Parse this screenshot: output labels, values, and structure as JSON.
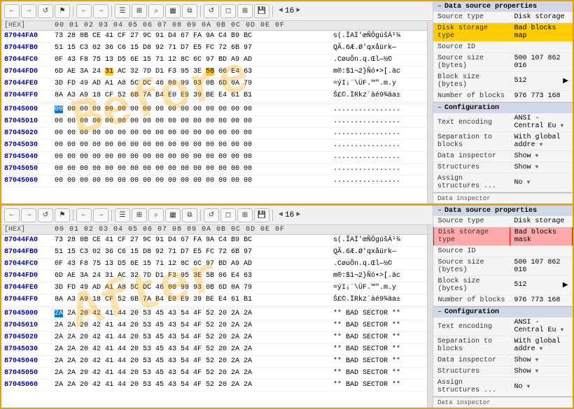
{
  "panels": [
    {
      "id": "top",
      "toolbar": {
        "buttons": [
          "←",
          "→",
          "↺",
          "⚑",
          "←",
          "→",
          "≡",
          "⊞",
          "☰",
          "⌕",
          "▦",
          "⧉",
          "↺",
          "◻",
          "⊞",
          "💾"
        ],
        "page": "◄ 16 ►"
      },
      "header": {
        "addr": "[HEX]",
        "bytes": "00  01  02  03  04  05  06  07  08  09  0A  0B  0C  0D  0E  0F",
        "chars": ""
      },
      "rows": [
        {
          "addr": "87044FA0",
          "data": "73 28 0B CE 41 CF 27 9C 91 D4 67 FA 9A C4 B9 BC",
          "ascii": "s(.ÎAÏ'\\u009cÑÔgúšÄ¹¼"
        },
        {
          "addr": "87044FB0",
          "data": "51 15 C3 02 36 C6 15 D8 92 71 D7 E5 FC 72 6B 97",
          "ascii": "QÃ.6Æ.Ø\\u0092qxåür k\\u0097"
        },
        {
          "addr": "87044FC0",
          "data": "0F 43 F8 75 13 D5 6E 15 71 12 8C 6C 97 BD A9 AD",
          "ascii": ".CøuÕn.q.\\u008cl\\u0097½©"
        },
        {
          "addr": "87044FD0",
          "data": "6D AE 3A 24 31 AC 32 7D D1 F3 95 3E 5B 06 E4 63",
          "ascii": "m®:$1¬2}Ñó\\u0095>[.äc"
        },
        {
          "addr": "87044FE0",
          "data": "3D FD 49 AD A1 A8 5C DC 46 00 99 93 0B 6D 0A 79",
          "ascii": "=ýI\\u00ad¡¨\\\\ÜF.\\u0099\\u0093.m.y"
        },
        {
          "addr": "87044FF0",
          "data": "8A A3 A9 18 CF 52 6B 7A B4 E0 E9 39 BE E4 61 B1",
          "ascii": "\\u008a¢©.ÏRkz´àé9¾äa±"
        },
        {
          "addr": "",
          "data": "",
          "ascii": "",
          "empty": true
        },
        {
          "addr": "87045000",
          "data": "00 00 00 00 00 00 00 00 00 00 00 00 00 00 00 00",
          "ascii": "................",
          "highlight_byte": 0
        },
        {
          "addr": "87045010",
          "data": "00 00 00 00 00 00 00 00 00 00 00 00 00 00 00 00",
          "ascii": "................"
        },
        {
          "addr": "87045020",
          "data": "00 00 00 00 00 00 00 00 00 00 00 00 00 00 00 00",
          "ascii": "................"
        },
        {
          "addr": "87045030",
          "data": "00 00 00 00 00 00 00 00 00 00 00 00 00 00 00 00",
          "ascii": "................"
        },
        {
          "addr": "87045040",
          "data": "00 00 00 00 00 00 00 00 00 00 00 00 00 00 00 00",
          "ascii": "................"
        },
        {
          "addr": "87045050",
          "data": "00 00 00 00 00 00 00 00 00 00 00 00 00 00 00 00",
          "ascii": "................"
        },
        {
          "addr": "87045060",
          "data": "00 00 00 00 00 00 00 00 00 00 00 00 00 00 00 00",
          "ascii": "................"
        }
      ],
      "properties": {
        "header": "Data source properties",
        "items": [
          {
            "label": "Source type",
            "value": "Disk storage",
            "highlight": false
          },
          {
            "label": "Disk storage type",
            "value": "Bad blocks map",
            "highlight": true
          },
          {
            "label": "Source ID",
            "value": "",
            "highlight": false
          },
          {
            "label": "Source size (bytes)",
            "value": "500 107 862 016",
            "highlight": false
          },
          {
            "label": "Block size (bytes)",
            "value": "512",
            "highlight": false
          },
          {
            "label": "Number of blocks",
            "value": "976 773 168",
            "highlight": false
          }
        ]
      },
      "configuration": {
        "header": "Configuration",
        "items": [
          {
            "label": "Text encoding",
            "value": "ANSI - Central Eu ▼"
          },
          {
            "label": "Separation to blocks",
            "value": "With global addre ▼"
          },
          {
            "label": "Data inspector",
            "value": "Show ▼"
          },
          {
            "label": "Structures",
            "value": "Show ▼"
          },
          {
            "label": "Assign structures ...",
            "value": "No ▼"
          }
        ]
      }
    },
    {
      "id": "bottom",
      "toolbar": {
        "buttons": [
          "←",
          "→",
          "↺",
          "⚑",
          "←",
          "→",
          "≡",
          "⊞",
          "☰",
          "⌕",
          "▦",
          "⧉",
          "↺",
          "◻",
          "⊞",
          "💾"
        ],
        "page": "◄ 16 ►"
      },
      "header": {
        "addr": "[HEX]",
        "bytes": "00  01  02  03  04  05  06  07  08  09  0A  0B  0C  0D  0E  0F",
        "chars": ""
      },
      "rows": [
        {
          "addr": "87044FA0",
          "data": "73 28 0B CE 41 CF 27 9C 91 D4 67 FA 9A C4 B9 BC",
          "ascii": "s(.ÎAÏ'\\u009cÑÔgúšÄ¹¼"
        },
        {
          "addr": "87044FB0",
          "data": "51 15 C3 02 36 C6 15 D8 92 71 D7 E5 FC 72 6B 97",
          "ascii": "QÃ.6Æ.Ø\\u0092qxåür k\\u0097"
        },
        {
          "addr": "87044FC0",
          "data": "0F 43 F8 75 13 D5 6E 15 71 12 8C 6C 97 BD A9 AD",
          "ascii": ".CøuÕn.q.\\u008cl\\u0097½©"
        },
        {
          "addr": "87044FD0",
          "data": "6D AE 3A 24 31 AC 32 7D D1 F3 95 3E 5B 06 E4 63",
          "ascii": "m®:$1¬2}Ñó\\u0095>[.äc"
        },
        {
          "addr": "87044FE0",
          "data": "3D FD 49 AD A1 A8 5C DC 46 00 99 93 0B 6D 0A 79",
          "ascii": "=ýI\\u00ad¡¨\\\\ÜF.\\u0099\\u0093.m.y"
        },
        {
          "addr": "87044FF0",
          "data": "8A A3 A9 18 CF 52 6B 7A B4 E0 E9 39 BE E4 61 B1",
          "ascii": "\\u008a¢©.ÏRkz´àé9¾äa±"
        },
        {
          "addr": "",
          "data": "",
          "ascii": "",
          "empty": true
        },
        {
          "addr": "87045000",
          "data": "2A 2A 20 42 41 44 20 53 45 43 54 4F 52 20 2A 2A",
          "ascii": "** BAD SECTOR **",
          "highlight_byte": 0,
          "first_byte": "2A"
        },
        {
          "addr": "87045010",
          "data": "2A 2A 20 42 41 44 20 53 45 43 54 4F 52 20 2A 2A",
          "ascii": "** BAD SECTOR **"
        },
        {
          "addr": "87045020",
          "data": "2A 2A 20 42 41 44 20 53 45 43 54 4F 52 20 2A 2A",
          "ascii": "** BAD SECTOR **"
        },
        {
          "addr": "87045030",
          "data": "2A 2A 20 42 41 44 20 53 45 43 54 4F 52 20 2A 2A",
          "ascii": "** BAD SECTOR **"
        },
        {
          "addr": "87045040",
          "data": "2A 2A 20 42 41 44 20 53 45 43 54 4F 52 20 2A 2A",
          "ascii": "** BAD SECTOR **"
        },
        {
          "addr": "87045050",
          "data": "2A 2A 20 42 41 44 20 53 45 43 54 4F 52 20 2A 2A",
          "ascii": "** BAD SECTOR **"
        },
        {
          "addr": "87045060",
          "data": "2A 2A 20 42 41 44 20 53 45 43 54 4F 52 20 2A 2A",
          "ascii": "** BAD SECTOR **"
        }
      ],
      "properties": {
        "header": "Data source properties",
        "items": [
          {
            "label": "Source type",
            "value": "Disk storage",
            "highlight": false
          },
          {
            "label": "Disk storage type",
            "value": "Bad blocks mask",
            "highlight": true,
            "highlight_red": true
          },
          {
            "label": "Source ID",
            "value": "",
            "highlight": false
          },
          {
            "label": "Source size (bytes)",
            "value": "500 107 862 016",
            "highlight": false
          },
          {
            "label": "Block size (bytes)",
            "value": "512",
            "highlight": false
          },
          {
            "label": "Number of blocks",
            "value": "976 773 168",
            "highlight": false
          }
        ]
      },
      "configuration": {
        "header": "Configuration",
        "items": [
          {
            "label": "Text encoding",
            "value": "ANSI - Central Eu ▼"
          },
          {
            "label": "Separation to blocks",
            "value": "With global addre ▼"
          },
          {
            "label": "Data inspector",
            "value": "Show ▼"
          },
          {
            "label": "Structures",
            "value": "Show ▼"
          },
          {
            "label": "Assign structures ...",
            "value": "No ▼"
          }
        ]
      }
    }
  ],
  "watermarks": {
    "before": "Before",
    "after": "After"
  }
}
